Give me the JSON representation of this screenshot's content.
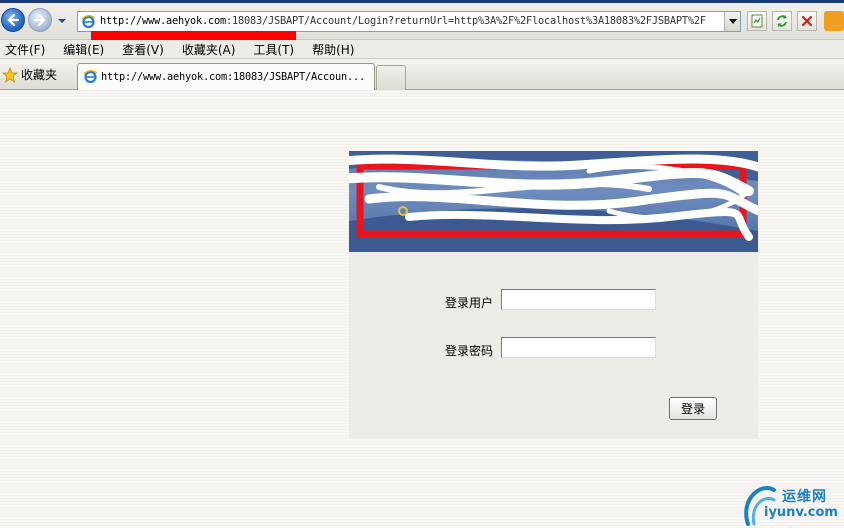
{
  "browser": {
    "address_url_host": "http://www.aehyok.com",
    "address_url_rest": ":18083/JSBAPT/Account/Login?returnUrl=http%3A%2F%2Flocalhost%3A18083%2FJSBAPT%2F",
    "tab_title": "http://www.aehyok.com:18083/JSBAPT/Accoun..."
  },
  "menu": {
    "items": [
      "文件(F)",
      "编辑(E)",
      "查看(V)",
      "收藏夹(A)",
      "工具(T)",
      "帮助(H)"
    ]
  },
  "favorites": {
    "label": "收藏夹"
  },
  "login": {
    "user_label": "登录用户",
    "password_label": "登录密码",
    "user_value": "",
    "password_value": "",
    "submit_label": "登录"
  },
  "watermark": {
    "cn": "运维网",
    "en": "iyunv.com"
  },
  "colors": {
    "redaction": "#ff0000",
    "banner_blue": "#5b79ad",
    "watermark_blue": "#1d7fc4"
  }
}
